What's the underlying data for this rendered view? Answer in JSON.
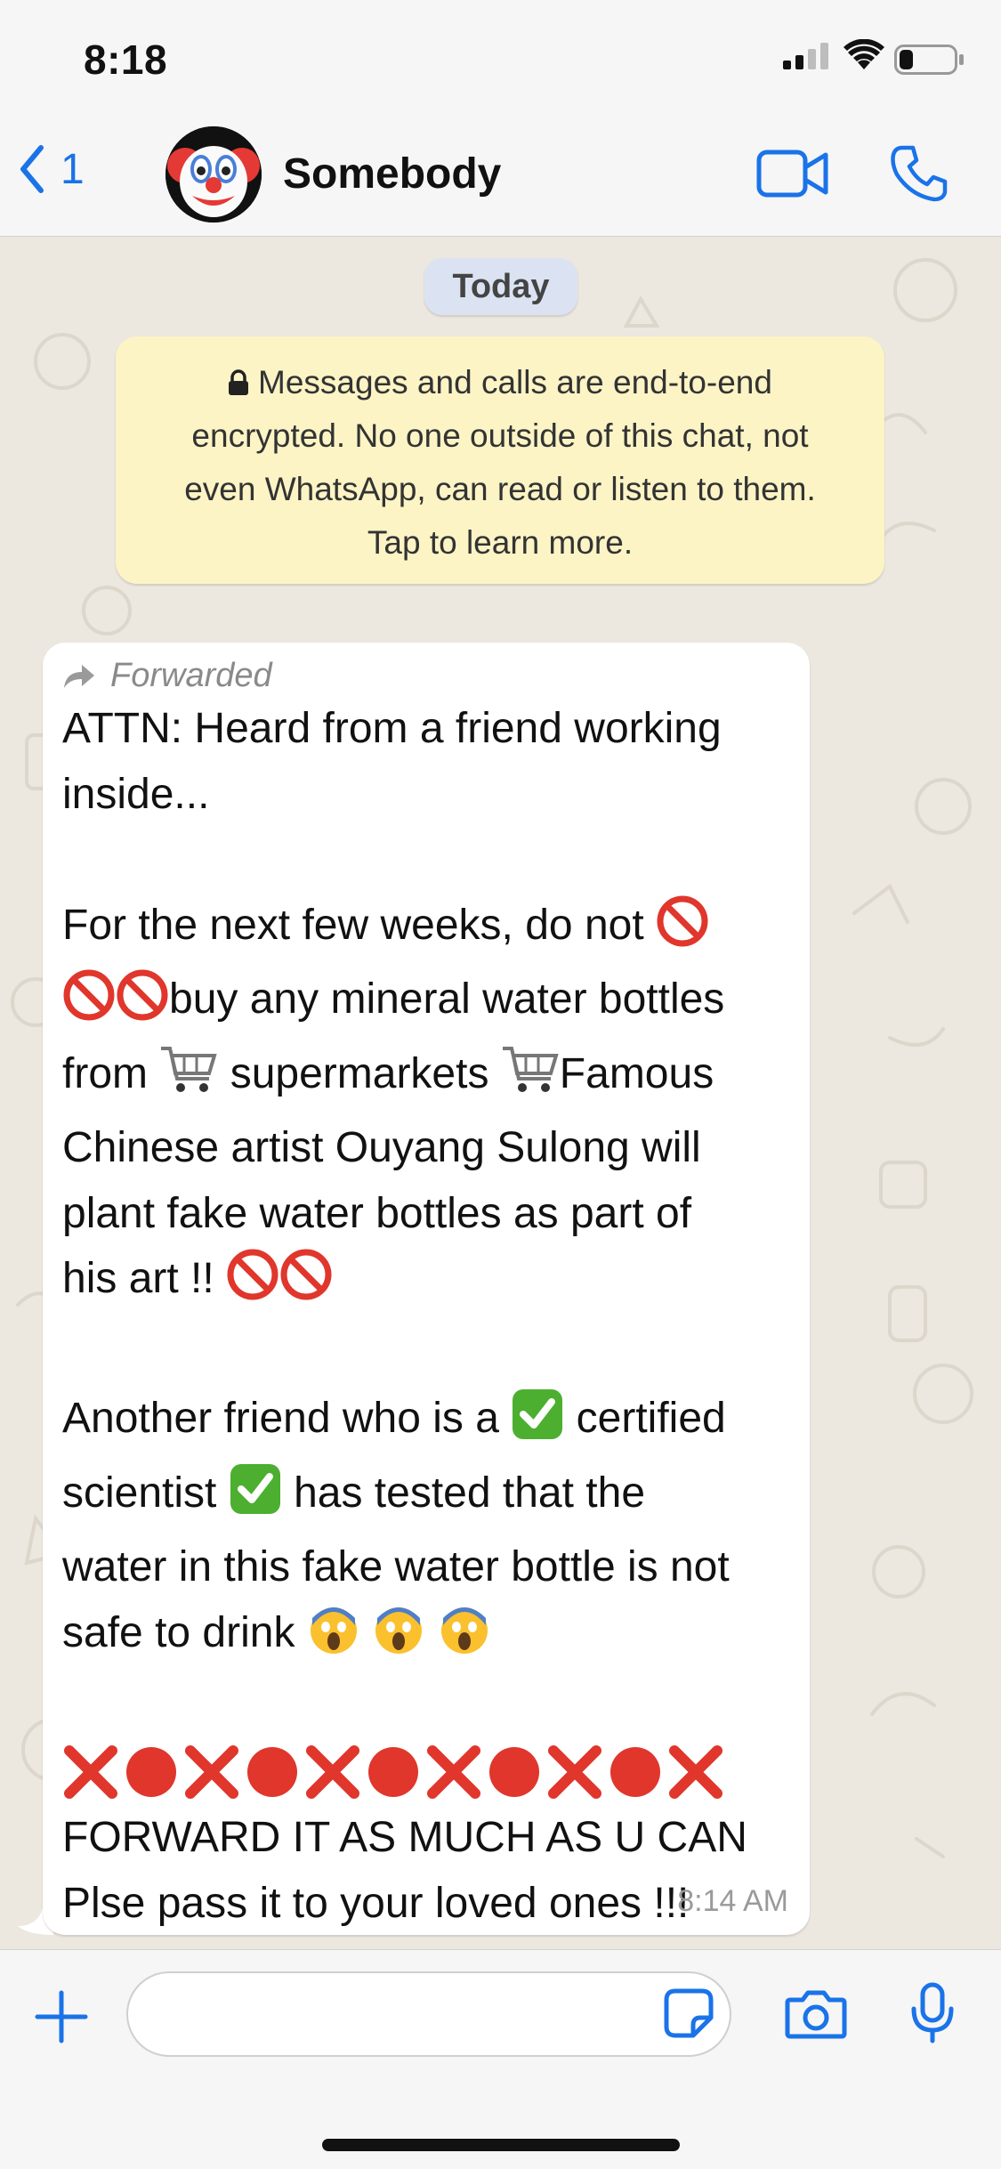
{
  "status_bar": {
    "time": "8:18",
    "battery_level": 0.25
  },
  "header": {
    "back_count": "1",
    "contact_name": "Somebody",
    "avatar_emoji": "clown-face",
    "accent": "#1a73e8"
  },
  "chat": {
    "date_pill": "Today",
    "encryption_notice": [
      "Messages and calls are end-to-end",
      "encrypted. No one outside of this chat, not",
      "even WhatsApp, can read or listen to them.",
      "Tap to learn more."
    ],
    "message": {
      "forwarded_label": "Forwarded",
      "line_a1": "ATTN: Heard from a friend working",
      "line_a2": "inside...",
      "line_b1": "For the next few weeks, do not",
      "line_b2": "buy any mineral water bottles",
      "line_b3a": "from",
      "line_b3b": "supermarkets",
      "line_b3c": "Famous",
      "line_b4": "Chinese artist Ouyang Sulong will",
      "line_b5": "plant fake water bottles as part of",
      "line_b6": "his art !!",
      "line_c1a": "Another friend who is a",
      "line_c1b": "certified",
      "line_c2a": "scientist",
      "line_c2b": "has tested that the",
      "line_c3": "water in this fake water bottle is not",
      "line_c4": "safe to drink",
      "line_d1": "FORWARD IT AS MUCH AS U CAN",
      "line_d2": "Plse pass it to your loved ones !!!",
      "time": "8:14 AM",
      "emoji_names": [
        "prohibited-icon",
        "shopping-cart-icon",
        "check-mark-button-icon",
        "screaming-face-icon",
        "cross-mark-icon",
        "red-circle-icon"
      ]
    }
  },
  "colors": {
    "bubble": "#ffffff",
    "notice_bg": "#fcf4c5",
    "pill_bg": "#dbe3f3",
    "chat_bg": "#ece7df"
  }
}
